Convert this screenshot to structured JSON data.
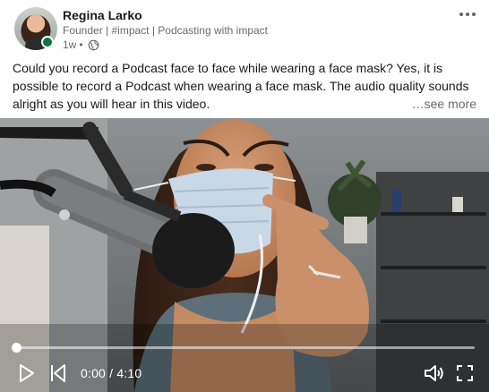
{
  "post": {
    "author_name": "Regina Larko",
    "headline": "Founder | #impact | Podcasting with impact",
    "time_ago": "1w",
    "separator": "•",
    "visibility_icon": "globe-icon",
    "more_icon": "ellipsis-icon",
    "online_status": "online",
    "text": "Could you record a Podcast face to face while wearing a face mask? Yes, it is possible to record a Podcast when wearing a face mask. The audio quality sounds alright as you will hear in this video.",
    "see_more_label": "…see more"
  },
  "video": {
    "current_time": "0:00",
    "duration": "4:10",
    "time_separator": " / ",
    "progress_fraction": 0,
    "controls": {
      "play_icon": "play-icon",
      "skip_back_icon": "skip-back-icon",
      "volume_icon": "volume-icon",
      "fullscreen_icon": "fullscreen-icon"
    }
  },
  "colors": {
    "presence_green": "#057642",
    "text_primary": "#191919",
    "text_secondary": "#666666"
  }
}
